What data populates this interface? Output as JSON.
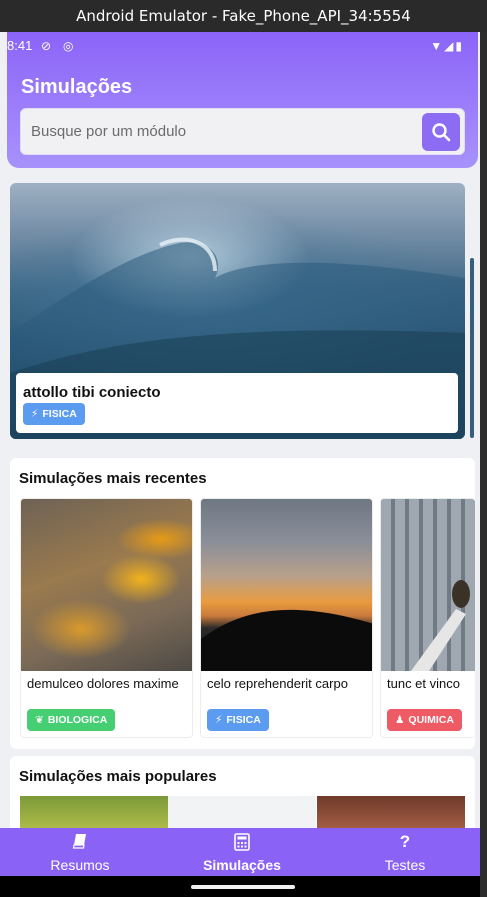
{
  "window": {
    "title": "Android Emulator - Fake_Phone_API_34:5554"
  },
  "status_bar": {
    "time": "8:41"
  },
  "header": {
    "title": "Simulações"
  },
  "search": {
    "placeholder": "Busque por um módulo"
  },
  "hero": {
    "title": "attollo tibi coniecto",
    "badge": "FISICA"
  },
  "recent": {
    "title": "Simulações mais recentes",
    "items": [
      {
        "title": "demulceo dolores maxime",
        "badge": "BIOLOGICA"
      },
      {
        "title": "celo reprehenderit carpo",
        "badge": "FISICA"
      },
      {
        "title": "tunc et vinco",
        "badge": "QUIMICA"
      }
    ]
  },
  "popular": {
    "title": "Simulações mais populares"
  },
  "nav": {
    "items": [
      {
        "label": "Resumos",
        "icon": "book-icon"
      },
      {
        "label": "Simulações",
        "icon": "calculator-icon",
        "active": true
      },
      {
        "label": "Testes",
        "icon": "question-icon"
      }
    ]
  },
  "colors": {
    "primary": "#8a63f6",
    "fisica": "#5b9bf0",
    "biologica": "#45cf72",
    "quimica": "#ef5b64"
  }
}
